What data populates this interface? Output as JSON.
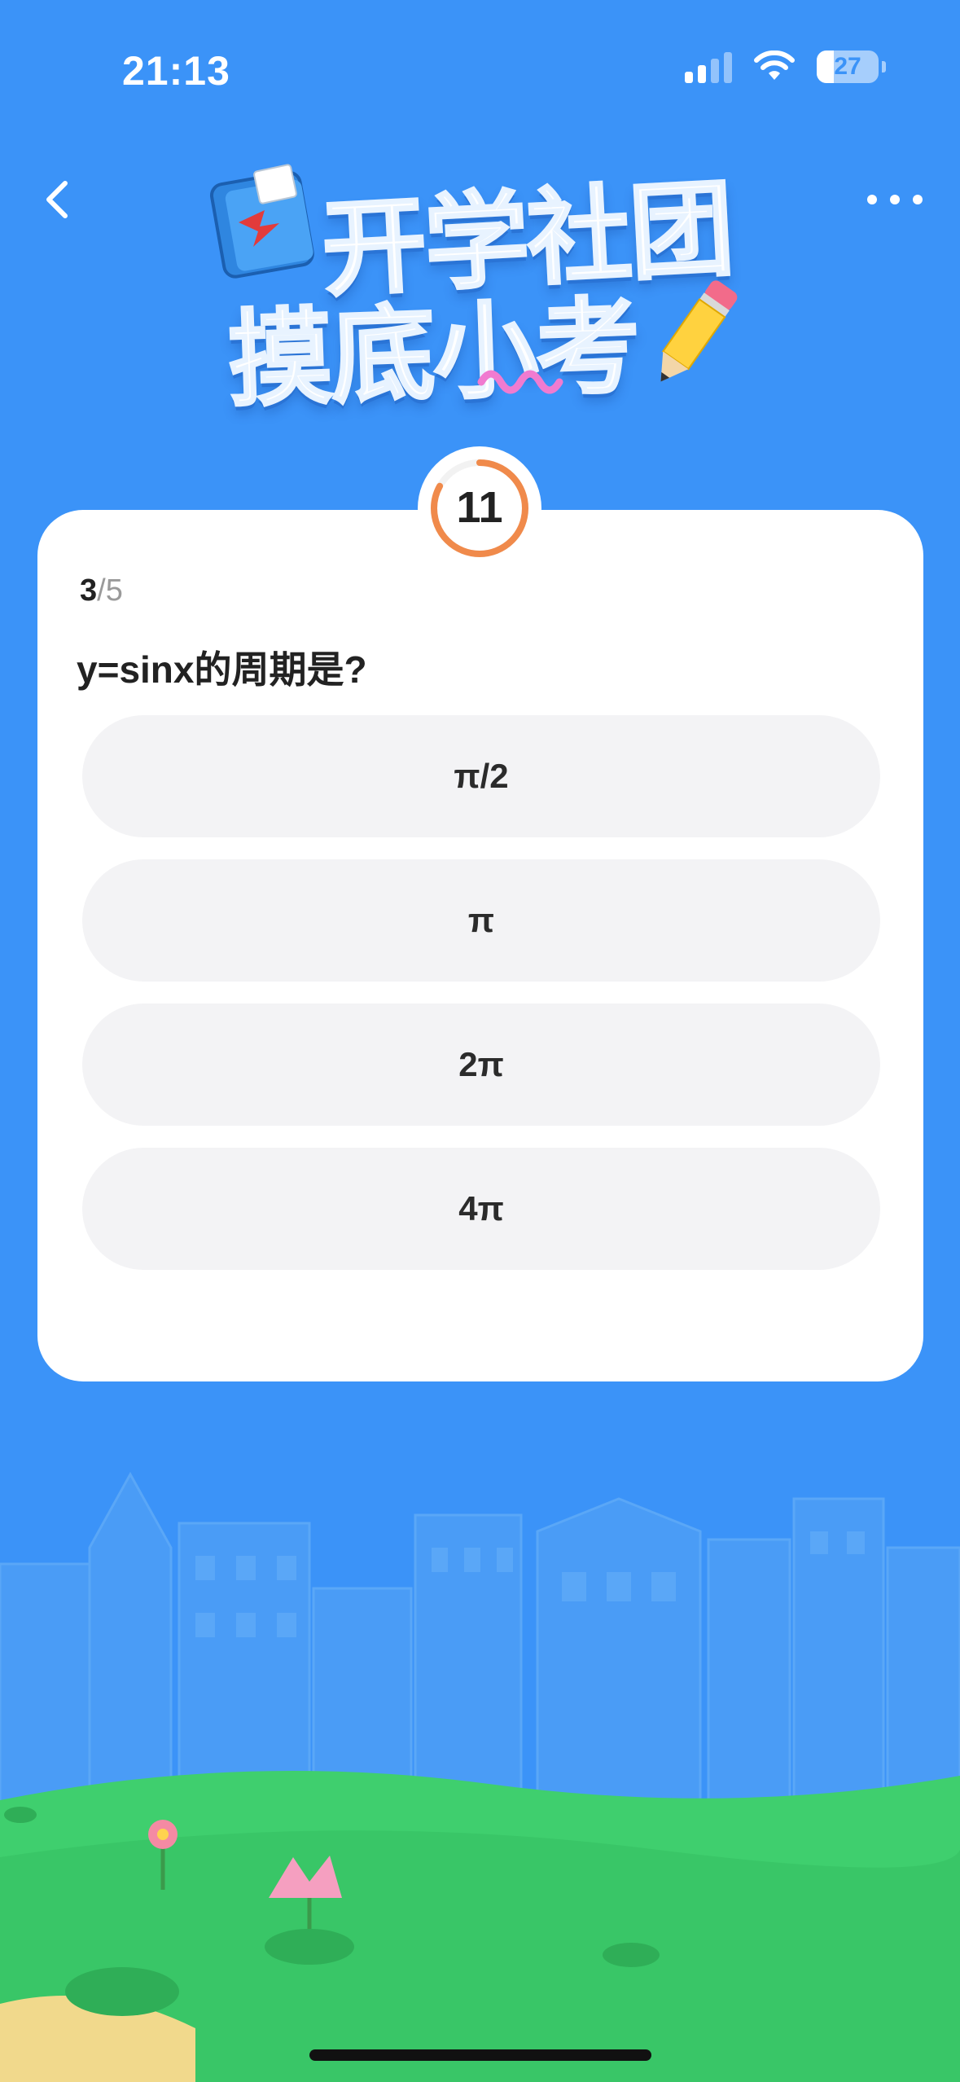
{
  "status_bar": {
    "time": "21:13",
    "battery_level": "27"
  },
  "header": {
    "title_line1": "开学社团",
    "title_line2": "摸底小考"
  },
  "quiz": {
    "timer_seconds": "11",
    "timer_progress": 0.83,
    "progress_current": "3",
    "progress_separator": "/",
    "progress_total": "5",
    "question": "y=sinx的周期是?",
    "options": [
      "π/2",
      "π",
      "2π",
      "4π"
    ]
  },
  "colors": {
    "background": "#3b93f8",
    "timer_ring": "#f08a4b",
    "option_bg": "#f3f3f5",
    "grass": "#3fcf6e"
  },
  "icons": {
    "back": "chevron-left-icon",
    "more": "ellipsis-icon",
    "signal": "signal-icon",
    "wifi": "wifi-icon",
    "battery": "battery-icon"
  }
}
